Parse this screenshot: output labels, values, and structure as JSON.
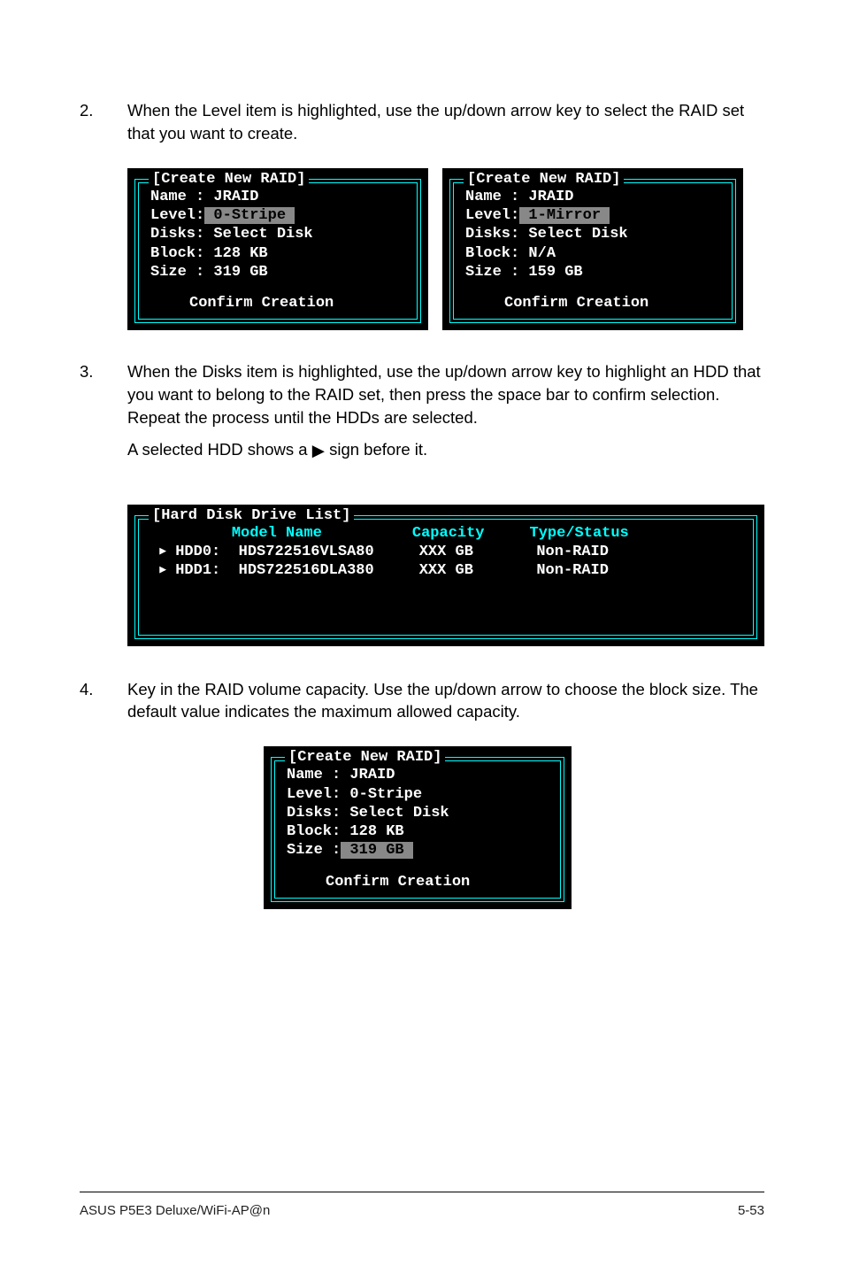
{
  "steps": {
    "s2": {
      "num": "2.",
      "text": "When the Level item is highlighted, use the up/down arrow key to select the RAID set that you want to create."
    },
    "s3": {
      "num": "3.",
      "text1": "When the Disks item is highlighted, use the up/down arrow key to highlight an HDD that you want to belong to the RAID set, then press the space bar to confirm selection. Repeat the process until the HDDs are selected.",
      "text2a": "A selected HDD shows a ",
      "text2b": " sign before it."
    },
    "s4": {
      "num": "4.",
      "text": "Key in the RAID volume capacity. Use the up/down arrow to choose the block size. The default value indicates the maximum allowed capacity."
    }
  },
  "term_a": {
    "title": "[Create New RAID]",
    "name": "Name : JRAID",
    "levelLabel": "Level:",
    "levelVal": " 0-Stripe ",
    "disks": "Disks: Select Disk",
    "block": "Block: 128 KB",
    "size": "Size : 319 GB",
    "confirm": "Confirm Creation"
  },
  "term_b": {
    "title": "[Create New RAID]",
    "name": "Name : JRAID",
    "levelLabel": "Level:",
    "levelVal": " 1-Mirror ",
    "disks": "Disks: Select Disk",
    "block": "Block: N/A",
    "size": "Size : 159 GB",
    "confirm": "Confirm Creation"
  },
  "hdd_list": {
    "title": "[Hard Disk Drive List]",
    "hdr_model": "Model Name",
    "hdr_cap": "Capacity",
    "hdr_type": "Type/Status",
    "rows": [
      {
        "slot": "HDD0:",
        "model": "HDS722516VLSA80",
        "cap": "XXX GB",
        "type": "Non-RAID"
      },
      {
        "slot": "HDD1:",
        "model": "HDS722516DLA380",
        "cap": "XXX GB",
        "type": "Non-RAID"
      }
    ]
  },
  "term_c": {
    "title": "[Create New RAID]",
    "name": "Name : JRAID",
    "level": "Level: 0-Stripe",
    "disks": "Disks: Select Disk",
    "block": "Block: 128 KB",
    "sizeLabel": "Size :",
    "sizeVal": " 319 GB ",
    "confirm": "Confirm Creation"
  },
  "footer": {
    "left": "ASUS P5E3 Deluxe/WiFi-AP@n",
    "right": "5-53"
  }
}
